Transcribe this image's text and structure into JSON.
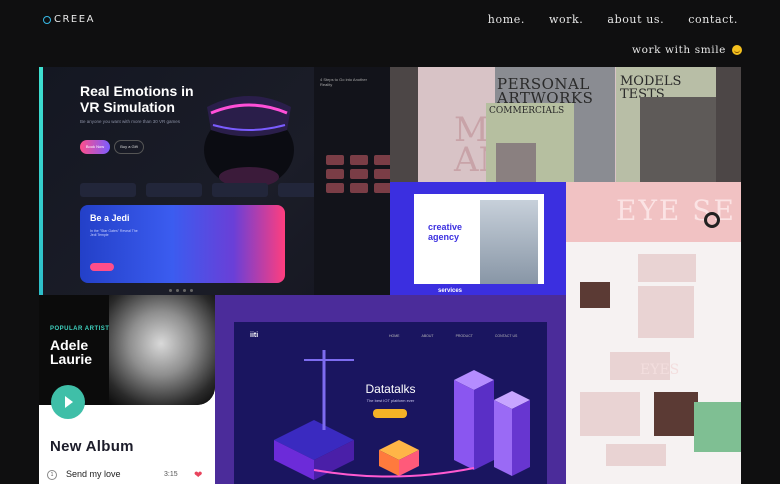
{
  "brand": {
    "logo_text": "CREEA",
    "accent": "#37b9e6"
  },
  "nav": {
    "items": [
      "home.",
      "work.",
      "about us.",
      "contact."
    ]
  },
  "tagline": {
    "text": "work with smile",
    "icon": "smile-emoji-icon"
  },
  "projects": {
    "vr": {
      "headline": "Real Emotions in VR Simulation",
      "subtitle": "Be anyone you want with more than 30 VR games",
      "btn_primary": "Book Now",
      "btn_secondary": "Buy a Gift",
      "side_title": "4 Steps to Go into Another Reality",
      "card_title": "Be a Jedi",
      "card_text": "In the \"Star Gates\" Reveal The Jedi Temple",
      "card_button": "Book Now"
    },
    "models": {
      "word_bg": "MA AN",
      "personal": "PERSONAL ARTWORKS",
      "commercials": "COMMERCIALS",
      "models_tests": "MODELS TESTS"
    },
    "agency": {
      "title": "creative agency",
      "services": "services"
    },
    "eyes": {
      "hero_word": "EYE SE",
      "lower_word": "EYES"
    },
    "adele": {
      "popular_label": "POPULAR ARTIST",
      "artist_name": "Adele Laurie",
      "album_heading": "New Album",
      "track_number": "1",
      "track_title": "Send my love",
      "track_time": "3:15"
    },
    "datatalks": {
      "logo": "iiti",
      "nav": [
        "HOME",
        "ABOUT",
        "PRODUCT",
        "CONTACT US"
      ],
      "title": "Datatalks",
      "subtitle": "The best IOT platform ever"
    }
  }
}
